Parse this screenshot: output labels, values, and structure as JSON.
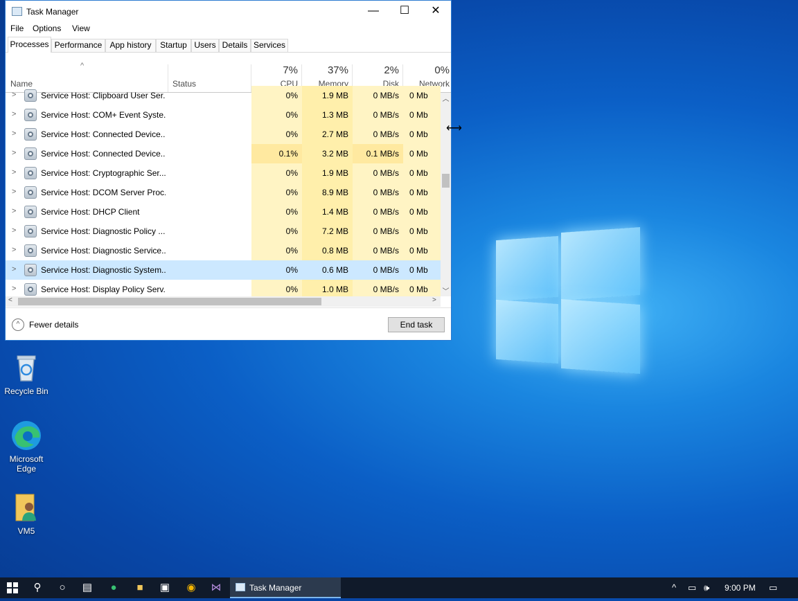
{
  "window": {
    "title": "Task Manager",
    "minimize": "—",
    "maximize": "☐",
    "close": "✕"
  },
  "menu": [
    "File",
    "Options",
    "View"
  ],
  "tabs": [
    "Processes",
    "Performance",
    "App history",
    "Startup",
    "Users",
    "Details",
    "Services"
  ],
  "active_tab": "Processes",
  "columns": {
    "name": "Name",
    "status": "Status",
    "cpu": {
      "label": "CPU",
      "pct": "7%"
    },
    "memory": {
      "label": "Memory",
      "pct": "37%"
    },
    "disk": {
      "label": "Disk",
      "pct": "2%"
    },
    "network": {
      "label": "Network",
      "pct": "0%"
    }
  },
  "rows": [
    {
      "name": "Service Host: Clipboard User Ser...",
      "cpu": "0%",
      "memory": "1.9 MB",
      "disk": "0 MB/s",
      "network": "0 Mb"
    },
    {
      "name": "Service Host: COM+ Event Syste...",
      "cpu": "0%",
      "memory": "1.3 MB",
      "disk": "0 MB/s",
      "network": "0 Mb"
    },
    {
      "name": "Service Host: Connected Device...",
      "cpu": "0%",
      "memory": "2.7 MB",
      "disk": "0 MB/s",
      "network": "0 Mb"
    },
    {
      "name": "Service Host: Connected Device...",
      "cpu": "0.1%",
      "memory": "3.2 MB",
      "disk": "0.1 MB/s",
      "network": "0 Mb"
    },
    {
      "name": "Service Host: Cryptographic Ser...",
      "cpu": "0%",
      "memory": "1.9 MB",
      "disk": "0 MB/s",
      "network": "0 Mb"
    },
    {
      "name": "Service Host: DCOM Server Proc...",
      "cpu": "0%",
      "memory": "8.9 MB",
      "disk": "0 MB/s",
      "network": "0 Mb"
    },
    {
      "name": "Service Host: DHCP Client",
      "cpu": "0%",
      "memory": "1.4 MB",
      "disk": "0 MB/s",
      "network": "0 Mb"
    },
    {
      "name": "Service Host: Diagnostic Policy ...",
      "cpu": "0%",
      "memory": "7.2 MB",
      "disk": "0 MB/s",
      "network": "0 Mb"
    },
    {
      "name": "Service Host: Diagnostic Service...",
      "cpu": "0%",
      "memory": "0.8 MB",
      "disk": "0 MB/s",
      "network": "0 Mb"
    },
    {
      "name": "Service Host: Diagnostic System...",
      "cpu": "0%",
      "memory": "0.6 MB",
      "disk": "0 MB/s",
      "network": "0 Mb"
    },
    {
      "name": "Service Host: Display Policy Serv...",
      "cpu": "0%",
      "memory": "1.0 MB",
      "disk": "0 MB/s",
      "network": "0 Mb"
    }
  ],
  "selected_row_index": 9,
  "footer": {
    "fewer_details": "Fewer details",
    "end_task": "End task"
  },
  "desktop_icons": [
    {
      "label": "Recycle Bin",
      "icon": "recycle-bin-icon"
    },
    {
      "label": "Microsoft Edge",
      "icon": "edge-icon"
    },
    {
      "label": "VM5",
      "icon": "user-folder-icon"
    }
  ],
  "taskbar": {
    "active_app": "Task Manager",
    "clock": "9:00 PM"
  }
}
